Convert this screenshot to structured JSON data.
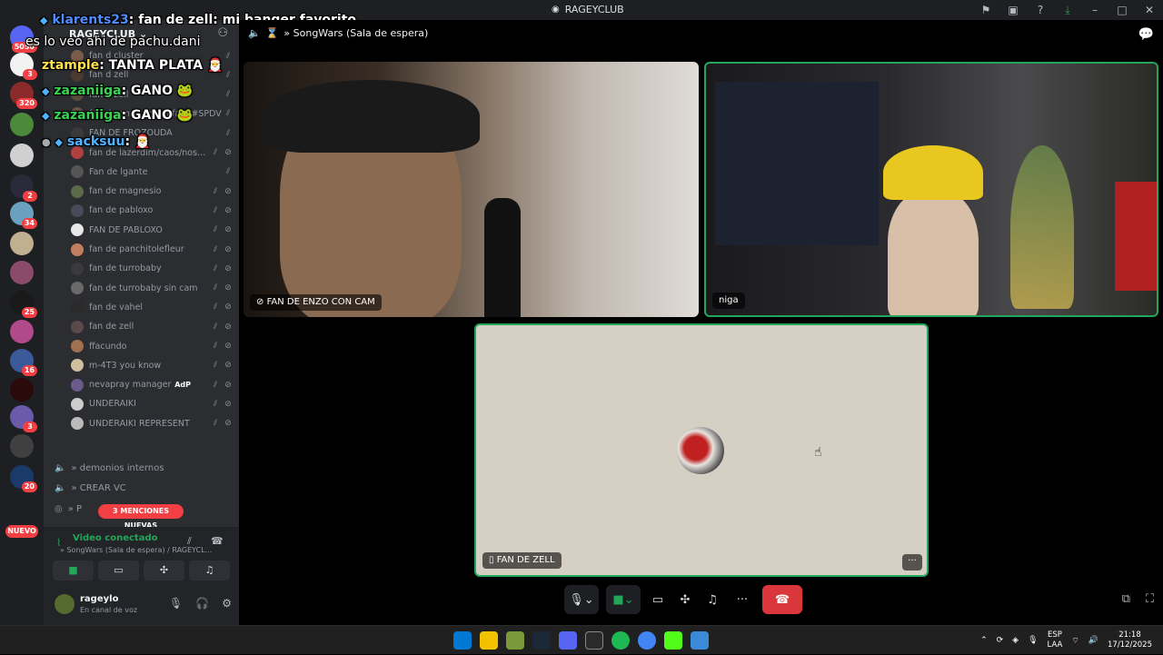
{
  "titlebar": {
    "title": "RAGEYCLUB",
    "icons": [
      "pin-icon",
      "inbox-icon",
      "help-icon",
      "download-icon",
      "minimize-icon",
      "maximize-icon",
      "close-icon"
    ]
  },
  "guilds": {
    "badges": [
      "5050",
      "3",
      "320",
      "2",
      "34",
      "25",
      "16",
      "20",
      "3"
    ],
    "new_label": "NUEVO"
  },
  "server": {
    "name": "RAGEYCLUB"
  },
  "voice_users": [
    {
      "name": "fan d cluster",
      "color": "#7a5b4a"
    },
    {
      "name": "fan d zell",
      "color": "#4a3a32"
    },
    {
      "name": "fan d zell",
      "color": "#5a4a3a"
    },
    {
      "name": "fan de enzo, jo, og fan. #SPDV",
      "color": "#6a5548"
    },
    {
      "name": "FAN DE FROZOUDA",
      "color": "#3a3a3a"
    },
    {
      "name": "fan de lazerdim/caos/nostos...",
      "color": "#b04040"
    },
    {
      "name": "Fan de lgante",
      "color": "#555555"
    },
    {
      "name": "fan de magnesio",
      "color": "#5a6a4a"
    },
    {
      "name": "fan de pabloxo",
      "color": "#4a4a5a"
    },
    {
      "name": "FAN DE PABLOXO",
      "color": "#e8e8e8"
    },
    {
      "name": "fan de panchitolefleur",
      "color": "#c08060"
    },
    {
      "name": "fan de turrobaby",
      "color": "#3a3a3a"
    },
    {
      "name": "fan de turrobaby sin cam",
      "color": "#6a6a6a"
    },
    {
      "name": "fan de vahel",
      "color": "#2a2a2a"
    },
    {
      "name": "fan de zell",
      "color": "#5a4a4a"
    },
    {
      "name": "ffacundo",
      "color": "#a07050"
    },
    {
      "name": "m-4T3 you know",
      "color": "#d0c0a0"
    },
    {
      "name": "nevapray manager",
      "color": "#6a5a8a"
    },
    {
      "name": "UNDERAIKI",
      "color": "#cccccc"
    },
    {
      "name": "UNDERAIKI REPRESENT",
      "color": "#bbbbbb"
    }
  ],
  "nevapray_tag": "AdP",
  "voice_channels": [
    {
      "name": "» demonios internos"
    },
    {
      "name": "» CREAR VC"
    },
    {
      "name": "» P"
    }
  ],
  "mentions_label": "3 MENCIONES NUEVAS",
  "voice_connection": {
    "status": "Video conectado",
    "channel": "» SongWars (Sala de espera) / RAGEYCL..."
  },
  "user": {
    "name": "rageylo",
    "status": "En canal de voz"
  },
  "overlay_chat": [
    {
      "user": "klarents23",
      "text": ": fan de zell: mi banger favorito",
      "user_color": "#4f8cff"
    },
    {
      "user": "",
      "text": "es lo veo ahi de pachu.dani",
      "user_color": "#ffffff"
    },
    {
      "user": "ztample",
      "text": ": TANTA PLATA",
      "user_color": "#ffe14d"
    },
    {
      "user": "zazaniiga",
      "text": ": GANO",
      "user_color": "#39d353"
    },
    {
      "user": "zazaniiga",
      "text": ": GANO",
      "user_color": "#39d353"
    },
    {
      "user": "sacksuu",
      "text": ":",
      "user_color": "#4fb3ff"
    }
  ],
  "call": {
    "channel": "» SongWars (Sala de espera)",
    "tiles": [
      {
        "label": "FAN DE ENZO CON CAM",
        "icon": "camera-off-icon"
      },
      {
        "label": "niga",
        "icon": ""
      },
      {
        "label": "FAN DE ZELL",
        "icon": "phone-icon"
      }
    ]
  },
  "taskbar": {
    "lang_top": "ESP",
    "lang_bottom": "LAA",
    "time": "21:18",
    "date": "17/12/2025"
  },
  "colors": {
    "accent_green": "#23a55a",
    "danger_red": "#da373c",
    "mention_red": "#f23f43",
    "tile_border_active": "#23a55a"
  }
}
